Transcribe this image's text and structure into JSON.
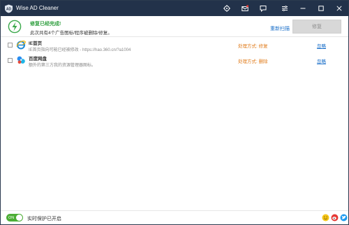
{
  "window": {
    "title": "Wise AD Cleaner"
  },
  "status": {
    "title": "修复已经完成!",
    "subtitle": "此次共有4个广告图标/程序被删除/修复。",
    "rescan_label": "重新扫描",
    "repair_label": "修复"
  },
  "items": [
    {
      "name": "IE首页",
      "description": "IE首页指向可能已经被修改 - https://hao.360.cn/?a1004",
      "method": "处理方式: 修复",
      "ignore_label": "忽略",
      "icon": "ie-icon"
    },
    {
      "name": "百度网盘",
      "description": "额外的第三方我的资源管理器图标。",
      "method": "处理方式: 删除",
      "ignore_label": "忽略",
      "icon": "baidu-netdisk-icon"
    }
  ],
  "footer": {
    "toggle_label": "ON",
    "protection_text": "实时保护已开启"
  },
  "colors": {
    "titlebar": "#22324a",
    "success": "#2e9e3e",
    "link": "#1a6fc9",
    "method": "#e07b1a",
    "toggle_on": "#4cae35"
  }
}
